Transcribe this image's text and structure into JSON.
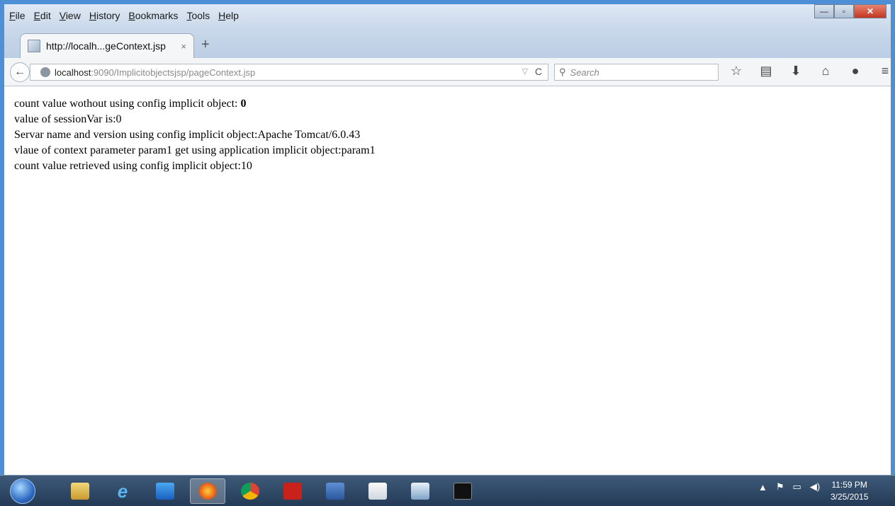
{
  "menu": [
    "File",
    "Edit",
    "View",
    "History",
    "Bookmarks",
    "Tools",
    "Help"
  ],
  "tab": {
    "title": "http://localh...geContext.jsp",
    "close": "×",
    "new_tab": "+"
  },
  "nav": {
    "back": "←",
    "url_host": "localhost",
    "url_rest": ":9090/Implicitobjectsjsp/pageContext.jsp",
    "search_placeholder": "Search",
    "icons": [
      "star-icon",
      "bookmarks-list-icon",
      "download-icon",
      "home-icon",
      "hello-icon",
      "menu-icon"
    ]
  },
  "content": {
    "line1_prefix": "count value wothout using config implicit object: ",
    "line1_value": "0",
    "line2": "value of sessionVar is:0",
    "line3": "Servar name and version using config implicit object:Apache Tomcat/6.0.43",
    "line4": "vlaue of context parameter param1 get using application implicit object:param1",
    "line5": "count value retrieved using config implicit object:10"
  },
  "taskbar": {
    "apps": [
      "file-explorer-icon",
      "internet-explorer-icon",
      "media-player-icon",
      "firefox-icon",
      "chrome-icon",
      "acrobat-icon",
      "word-icon",
      "java-icon",
      "presentation-icon",
      "cmd-icon"
    ],
    "time": "11:59 PM",
    "date": "3/25/2015"
  }
}
